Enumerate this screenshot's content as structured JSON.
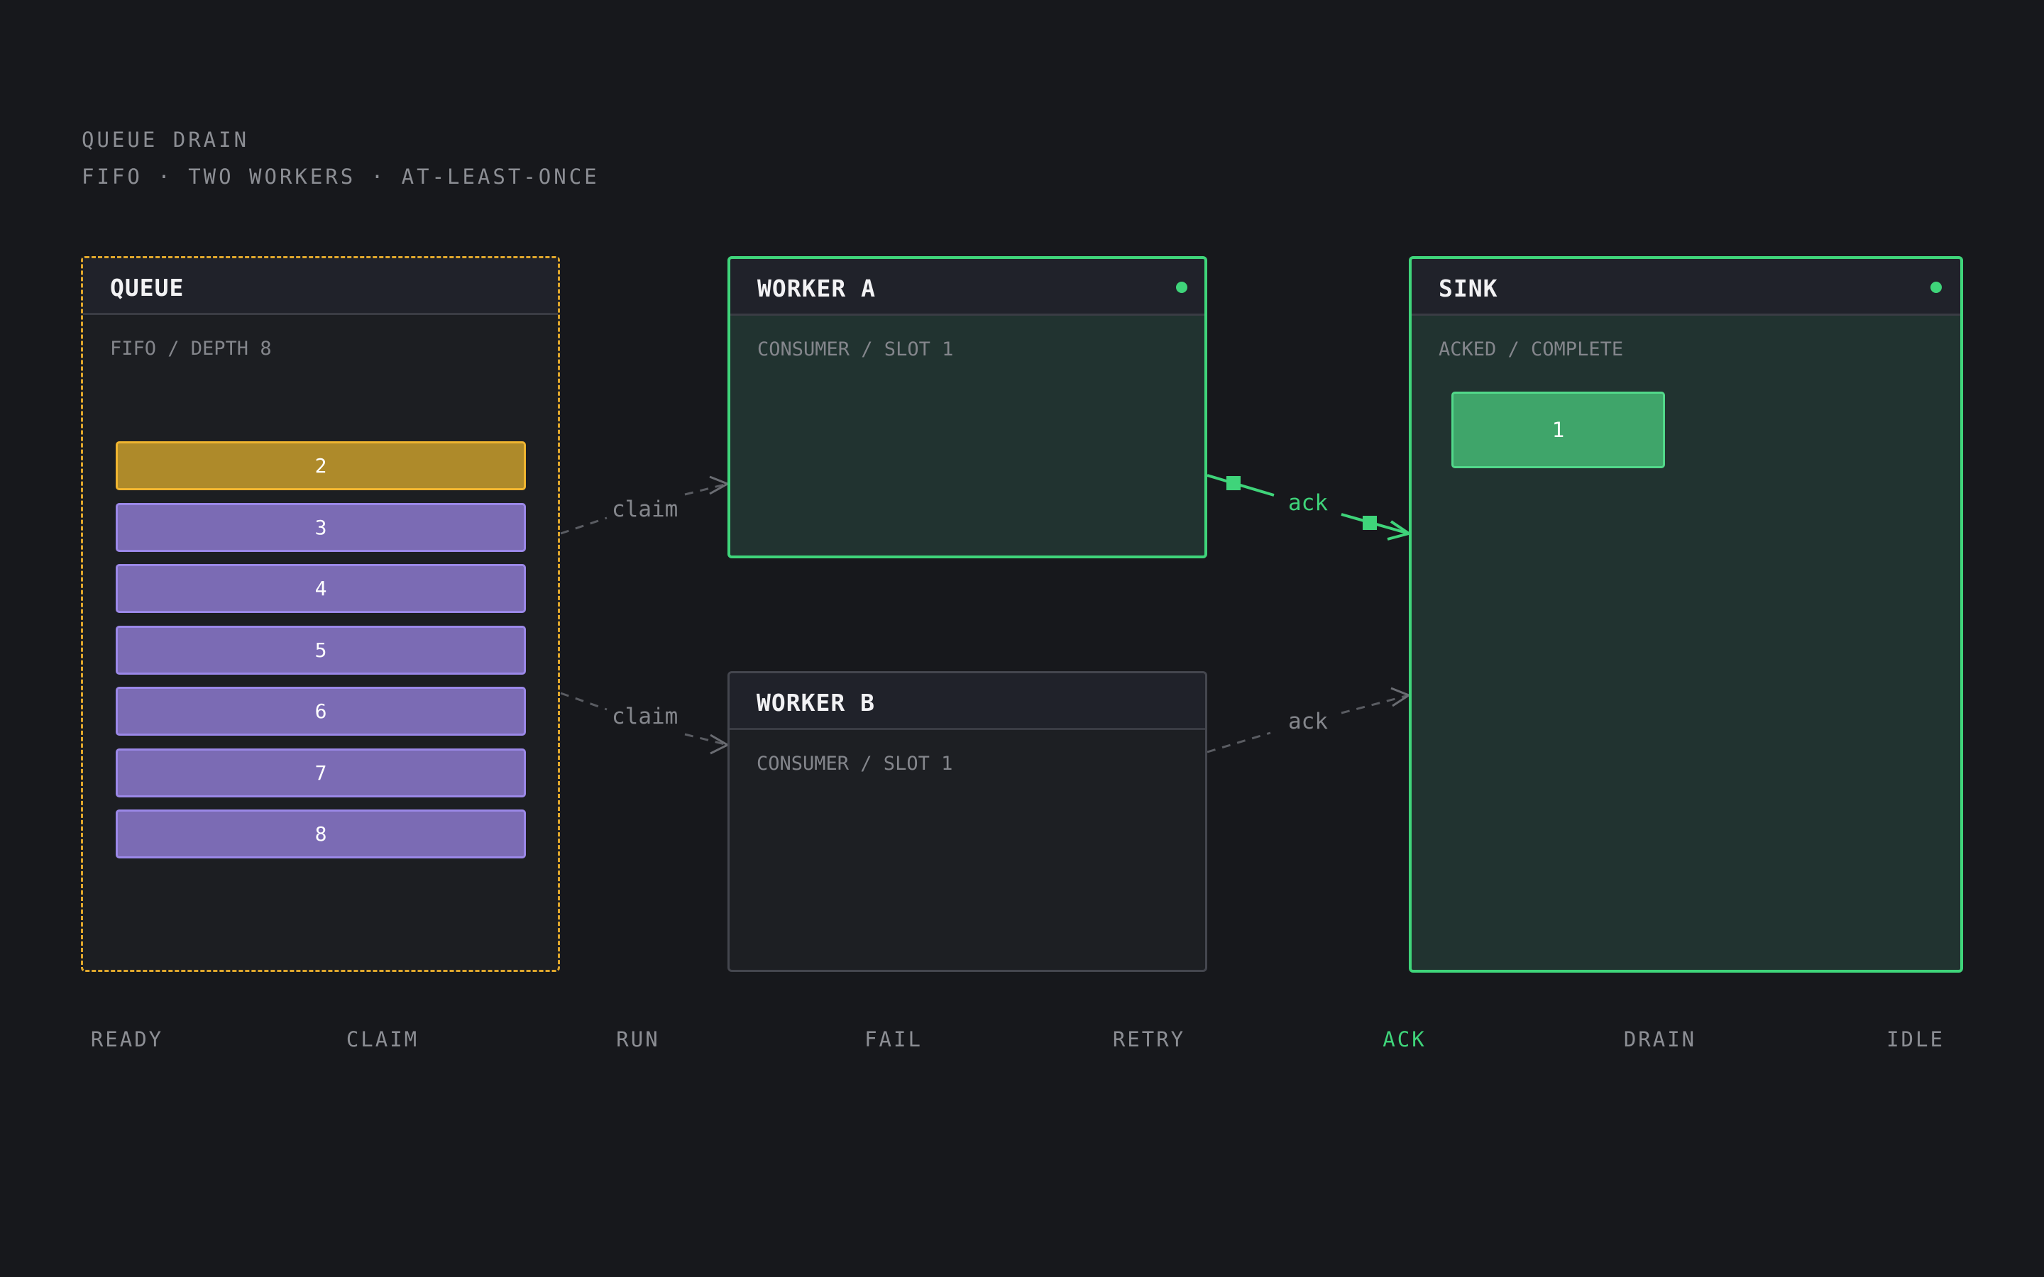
{
  "header": {
    "title": "QUEUE DRAIN",
    "subtitle": "FIFO · TWO WORKERS · AT-LEAST-ONCE"
  },
  "queue": {
    "title": "QUEUE",
    "subtitle": "FIFO / DEPTH 8",
    "jobs": [
      "2",
      "3",
      "4",
      "5",
      "6",
      "7",
      "8"
    ],
    "active_job": "2"
  },
  "worker_a": {
    "title": "WORKER A",
    "subtitle": "CONSUMER / SLOT 1",
    "status": "active"
  },
  "worker_b": {
    "title": "WORKER B",
    "subtitle": "CONSUMER / SLOT 1",
    "status": "idle"
  },
  "sink": {
    "title": "SINK",
    "subtitle": "ACKED / COMPLETE",
    "jobs": [
      "1"
    ],
    "status": "active"
  },
  "edges": {
    "queue_to_a": "claim",
    "queue_to_b": "claim",
    "a_to_sink": "ack",
    "b_to_sink": "ack"
  },
  "steps": [
    "READY",
    "CLAIM",
    "RUN",
    "FAIL",
    "RETRY",
    "ACK",
    "DRAIN",
    "IDLE"
  ],
  "current_step": "ACK",
  "colors": {
    "background": "#17181c",
    "active_green": "#3fd47a",
    "queue_amber": "#e0a72c",
    "job_purple": "#7b6bb4",
    "dim_text": "#8c8e94"
  }
}
